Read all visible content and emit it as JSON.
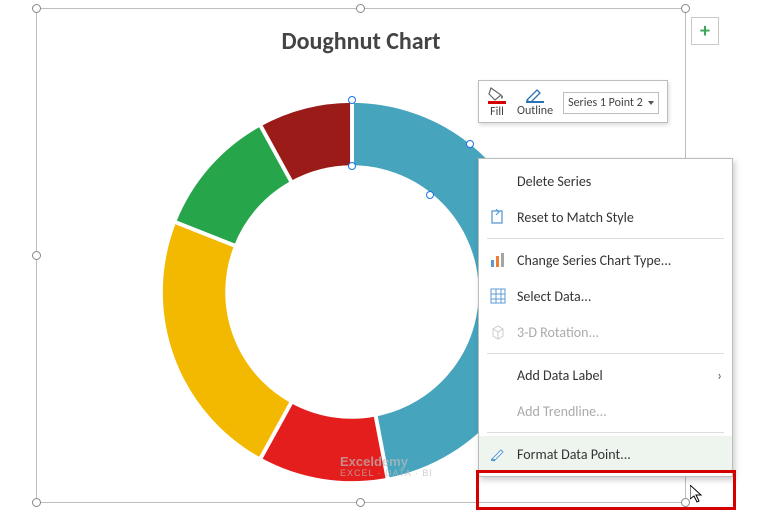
{
  "chart": {
    "title": "Doughnut Chart"
  },
  "chart_data": {
    "type": "doughnut",
    "title": "Doughnut Chart",
    "series": [
      {
        "name": "Series 1",
        "colors": [
          "#46a4bd",
          "#e41d1d",
          "#f3b800",
          "#26a54a",
          "#9a1b18"
        ],
        "values": [
          47,
          11,
          23,
          11,
          8
        ]
      }
    ],
    "selected_point_index": 1,
    "note": "values are estimated percentages of 360° sweep from visual geometry"
  },
  "toolbar": {
    "fill_label": "Fill",
    "outline_label": "Outline",
    "series_selector": "Series 1 Point 2"
  },
  "context_menu": {
    "delete_series": "Delete Series",
    "reset_style": "Reset to Match Style",
    "change_chart_type": "Change Series Chart Type...",
    "select_data": "Select Data...",
    "rotation": "3-D Rotation...",
    "add_data_label": "Add Data Label",
    "add_trendline": "Add Trendline...",
    "format_data_point": "Format Data Point..."
  },
  "watermark": {
    "line1": "Exceldemy",
    "line2": "EXCEL · DATA · BI"
  }
}
